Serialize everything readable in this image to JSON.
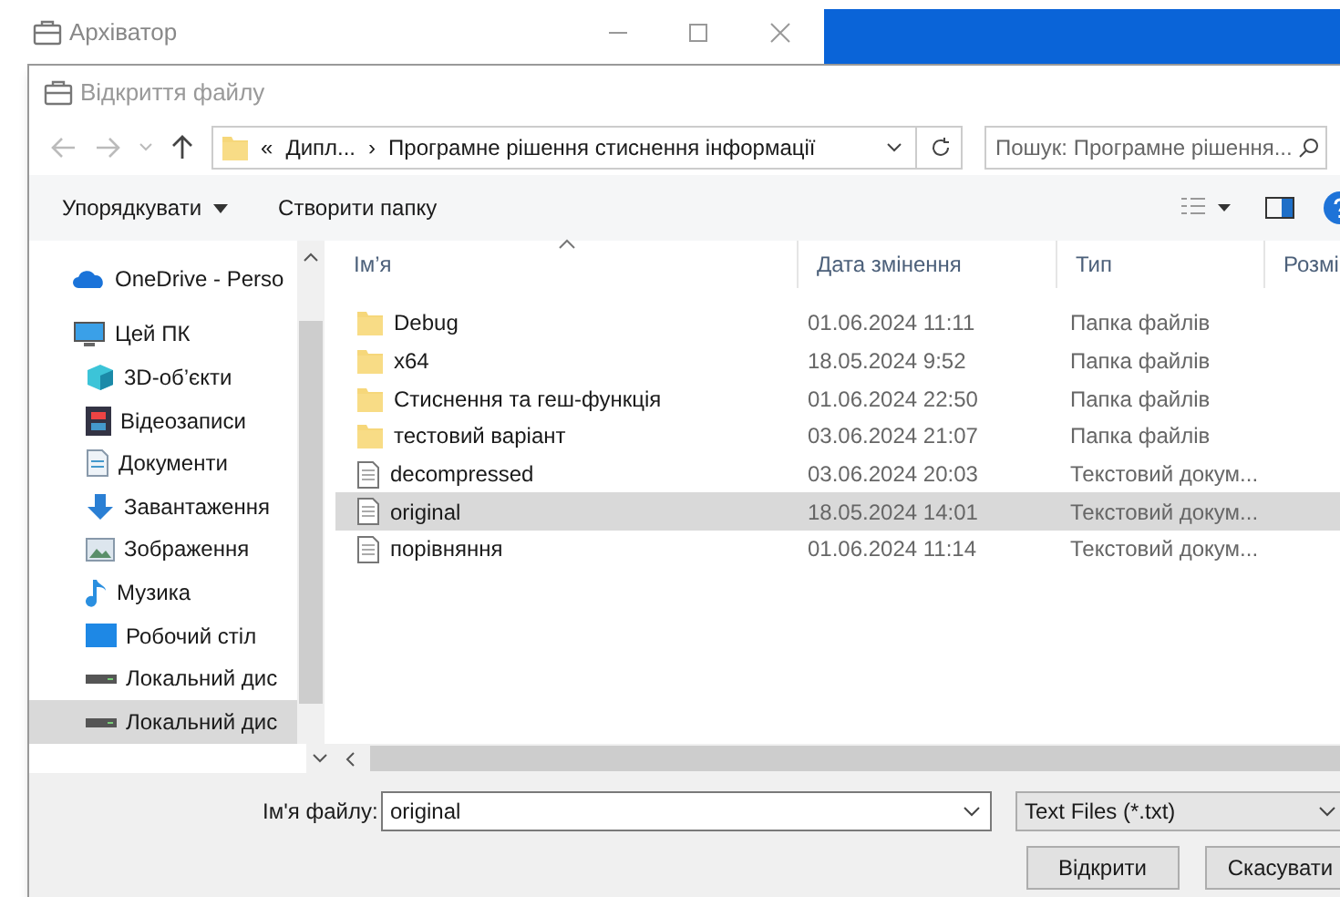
{
  "back_window": {
    "title": "Архіватор"
  },
  "dialog": {
    "title": "Відкриття файлу",
    "address": {
      "crumbs": [
        "«",
        "Дипл...",
        "›",
        "Програмне рішення стиснення інформації"
      ]
    },
    "search": {
      "placeholder": "Пошук: Програмне рішення..."
    },
    "toolbar": {
      "organize": "Упорядкувати",
      "new_folder": "Створити папку"
    },
    "sidebar": {
      "items": [
        {
          "label": "OneDrive - Perso",
          "kind": "cloud",
          "selected": false
        },
        {
          "label": "Цей ПК",
          "kind": "pc",
          "selected": false,
          "children": [
            {
              "label": "3D-об’єкти",
              "kind": "cube",
              "selected": false
            },
            {
              "label": "Відеозаписи",
              "kind": "video",
              "selected": false
            },
            {
              "label": "Документи",
              "kind": "doc",
              "selected": false
            },
            {
              "label": "Завантаження",
              "kind": "download",
              "selected": false
            },
            {
              "label": "Зображення",
              "kind": "image",
              "selected": false
            },
            {
              "label": "Музика",
              "kind": "music",
              "selected": false
            },
            {
              "label": "Робочий стіл",
              "kind": "desktop",
              "selected": false
            },
            {
              "label": "Локальний дис",
              "kind": "drive",
              "selected": false
            },
            {
              "label": "Локальний дис",
              "kind": "drive",
              "selected": true
            }
          ]
        }
      ]
    },
    "table": {
      "columns": [
        "Ім’я",
        "Дата змінення",
        "Тип",
        "Розмі"
      ],
      "rows": [
        {
          "name": "Debug",
          "date": "01.06.2024 11:11",
          "type": "Папка файлів",
          "kind": "folder",
          "selected": false
        },
        {
          "name": "x64",
          "date": "18.05.2024 9:52",
          "type": "Папка файлів",
          "kind": "folder",
          "selected": false
        },
        {
          "name": "Стиснення та геш-функція",
          "date": "01.06.2024 22:50",
          "type": "Папка файлів",
          "kind": "folder",
          "selected": false
        },
        {
          "name": "тестовий варіант",
          "date": "03.06.2024 21:07",
          "type": "Папка файлів",
          "kind": "folder",
          "selected": false
        },
        {
          "name": "decompressed",
          "date": "03.06.2024 20:03",
          "type": "Текстовий докум...",
          "kind": "file",
          "selected": false
        },
        {
          "name": "original",
          "date": "18.05.2024 14:01",
          "type": "Текстовий докум...",
          "kind": "file",
          "selected": true
        },
        {
          "name": "порівняння",
          "date": "01.06.2024 11:14",
          "type": "Текстовий докум...",
          "kind": "file",
          "selected": false
        }
      ]
    },
    "filename": {
      "label": "Ім'я файлу:",
      "value": "original"
    },
    "filter": {
      "value": "Text Files (*.txt)"
    },
    "buttons": [
      "Відкрити",
      "Скасувати"
    ]
  }
}
